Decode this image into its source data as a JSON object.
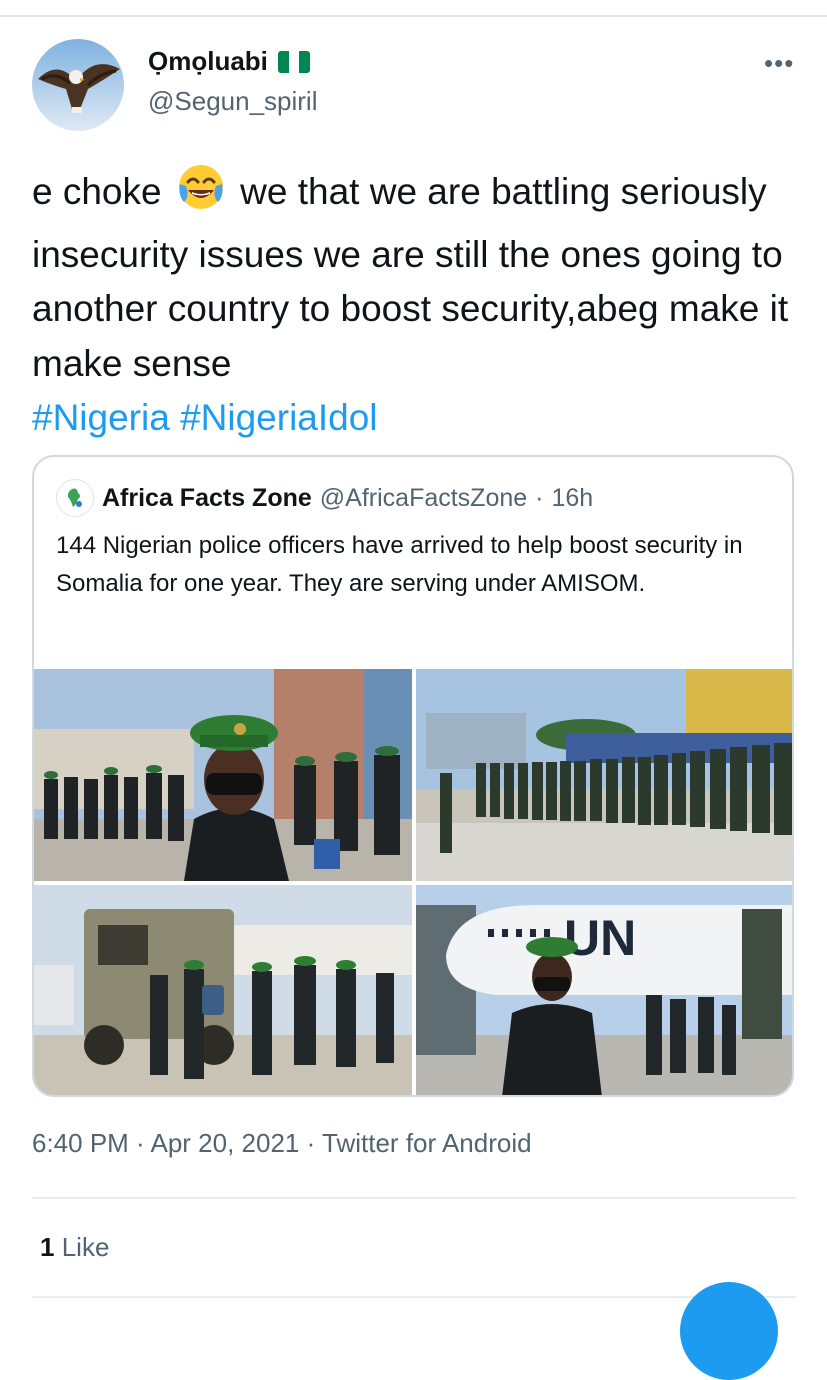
{
  "tweet": {
    "author": {
      "name": "Ọmọluabi",
      "handle": "@Segun_spiril",
      "flag": "nigeria-flag"
    },
    "text": {
      "before_emoji": "e choke",
      "emoji": "face-with-tears-of-joy",
      "after_emoji": "we that we are battling seriously insecurity issues we are still the ones going to another country to boost security,abeg make it make sense",
      "hashtags": [
        "#Nigeria",
        "#NigeriaIdol"
      ]
    },
    "timestamp": "6:40 PM · Apr 20, 2021 · Twitter for Android",
    "likes": {
      "count": "1",
      "label": "Like"
    }
  },
  "quoted": {
    "name": "Africa Facts Zone",
    "handle": "@AfricaFactsZone",
    "separator": "·",
    "time": "16h",
    "text": "144 Nigerian police officers have arrived to help boost security in Somalia for one year. They are serving under AMISOM.",
    "photos": [
      {
        "name": "officer-closeup-photo"
      },
      {
        "name": "officers-line-photo"
      },
      {
        "name": "armored-vehicle-photo"
      },
      {
        "name": "un-plane-photo",
        "text": "UN"
      }
    ]
  },
  "colors": {
    "link": "#1d9bf0",
    "secondary_text": "#536471",
    "border": "#cfd9de",
    "flag_green": "#008751"
  }
}
